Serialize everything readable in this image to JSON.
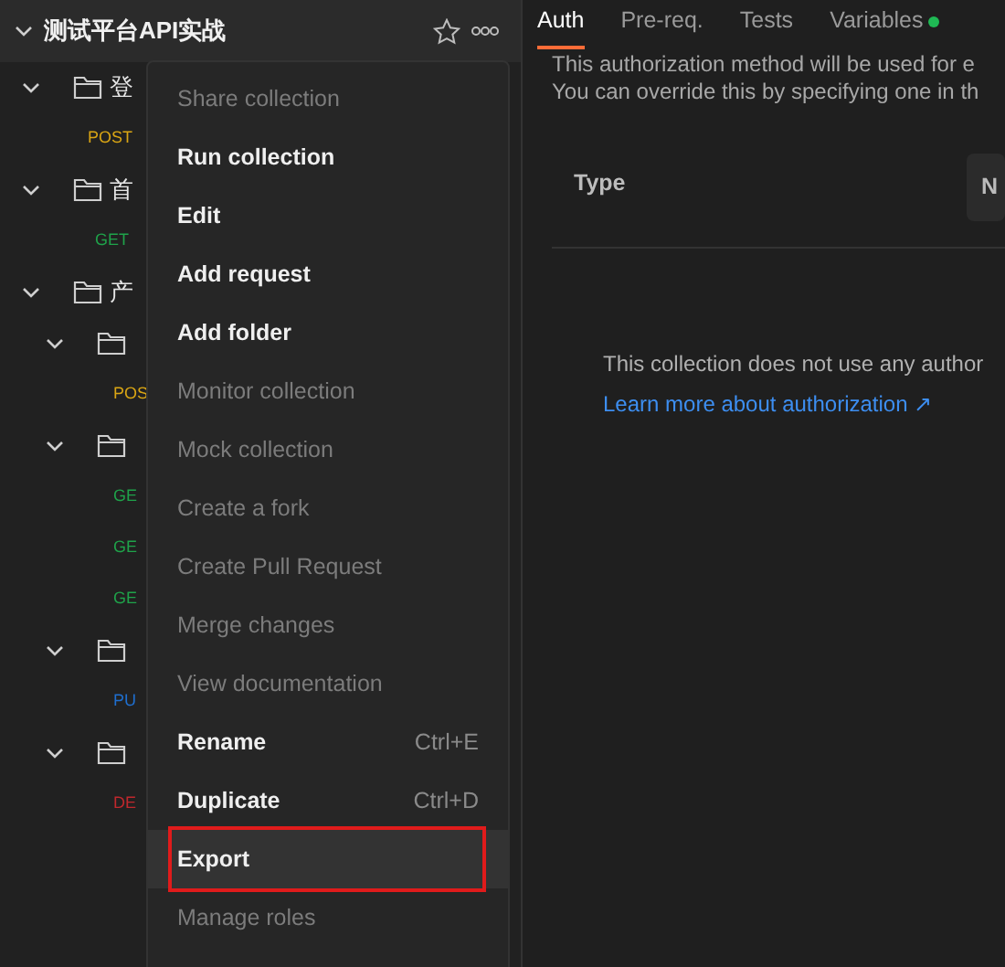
{
  "sidebar": {
    "collection": {
      "name": "测试平台API实战",
      "expanded": true,
      "starred": false,
      "children": [
        {
          "kind": "folder",
          "name": "登",
          "expanded": true,
          "children": [
            {
              "kind": "request",
              "method": "POST",
              "color": "#d9a514"
            }
          ]
        },
        {
          "kind": "folder",
          "name": "首",
          "expanded": true,
          "children": [
            {
              "kind": "request",
              "method": "GET",
              "color": "#1fa34a"
            }
          ]
        },
        {
          "kind": "folder",
          "name": "产",
          "expanded": true,
          "children": [
            {
              "kind": "folder",
              "expanded": true,
              "children": [
                {
                  "kind": "request",
                  "method": "POS",
                  "color": "#d9a514"
                }
              ]
            },
            {
              "kind": "folder",
              "expanded": true,
              "children": [
                {
                  "kind": "request",
                  "method": "GE",
                  "color": "#1fa34a"
                },
                {
                  "kind": "request",
                  "method": "GE",
                  "color": "#1fa34a"
                },
                {
                  "kind": "request",
                  "method": "GE",
                  "color": "#1fa34a"
                }
              ]
            },
            {
              "kind": "folder",
              "expanded": true,
              "children": [
                {
                  "kind": "request",
                  "method": "PU",
                  "color": "#1f6fd0"
                }
              ]
            },
            {
              "kind": "folder",
              "expanded": true,
              "children": [
                {
                  "kind": "request",
                  "method": "DE",
                  "color": "#c0282d"
                }
              ]
            }
          ]
        }
      ]
    }
  },
  "context_menu": {
    "items": [
      {
        "label": "Share collection",
        "disabled": true,
        "selected": false
      },
      {
        "label": "Run collection",
        "disabled": false,
        "selected": false
      },
      {
        "label": "Edit",
        "disabled": false,
        "selected": false
      },
      {
        "label": "Add request",
        "disabled": false,
        "selected": false
      },
      {
        "label": "Add folder",
        "disabled": false,
        "selected": false
      },
      {
        "label": "Monitor collection",
        "disabled": true,
        "selected": false
      },
      {
        "label": "Mock collection",
        "disabled": true,
        "selected": false
      },
      {
        "label": "Create a fork",
        "disabled": true,
        "selected": false
      },
      {
        "label": "Create Pull Request",
        "disabled": true,
        "selected": false
      },
      {
        "label": "Merge changes",
        "disabled": true,
        "selected": false
      },
      {
        "label": "View documentation",
        "disabled": true,
        "selected": false
      },
      {
        "label": "Rename",
        "shortcut": "Ctrl+E",
        "disabled": false,
        "selected": false
      },
      {
        "label": "Duplicate",
        "shortcut": "Ctrl+D",
        "disabled": false,
        "selected": false
      },
      {
        "label": "Export",
        "disabled": false,
        "selected": true,
        "highlighted": true
      },
      {
        "label": "Manage roles",
        "disabled": true,
        "selected": false
      }
    ]
  },
  "tabs": [
    {
      "label": "Auth",
      "selected": true
    },
    {
      "label": "Pre-req.",
      "selected": false
    },
    {
      "label": "Tests",
      "selected": false
    },
    {
      "label": "Variables",
      "selected": false,
      "color": "#1fb954"
    }
  ],
  "auth": {
    "description": [
      "This authorization method will be used for e",
      "You can override this by specifying one in th"
    ],
    "type_label": "Type",
    "type_value": "N",
    "empty_message": "This collection does not use any author",
    "link": "Learn more about authorization ↗"
  }
}
